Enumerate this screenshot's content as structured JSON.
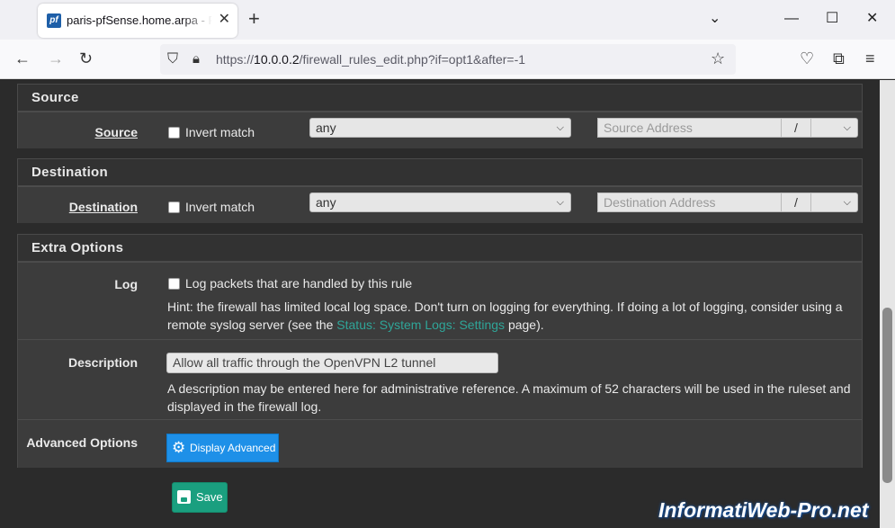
{
  "browser": {
    "tab_title": "paris-pfSense.home.arpa - Firewall",
    "tab_favicon": "pf",
    "url_prefix": "https://",
    "url_host": "10.0.0.2",
    "url_path": "/firewall_rules_edit.php?if=opt1&after=-1"
  },
  "source": {
    "section_title": "Source",
    "label": "Source",
    "invert_label": "Invert match",
    "type_value": "any",
    "address_placeholder": "Source Address",
    "slash": "/"
  },
  "destination": {
    "section_title": "Destination",
    "label": "Destination",
    "invert_label": "Invert match",
    "type_value": "any",
    "address_placeholder": "Destination Address",
    "slash": "/"
  },
  "extra": {
    "section_title": "Extra Options",
    "log_label": "Log",
    "log_checkbox_label": "Log packets that are handled by this rule",
    "log_hint_1": "Hint: the firewall has limited local log space. Don't turn on logging for everything. If doing a lot of logging, consider using a",
    "log_hint_2_pre": "remote syslog server (see the ",
    "log_hint_link": "Status: System Logs: Settings",
    "log_hint_2_post": " page).",
    "description_label": "Description",
    "description_value": "Allow all traffic through the OpenVPN L2 tunnel",
    "description_hint_1": "A description may be entered here for administrative reference. A maximum of 52 characters will be used in the ruleset and",
    "description_hint_2": "displayed in the firewall log.",
    "advanced_label": "Advanced Options",
    "advanced_button": "Display Advanced"
  },
  "save_button": "Save",
  "watermark": "InformatiWeb-Pro.net",
  "colors": {
    "accent_blue": "#1e90e8",
    "save_green": "#1a9f7f",
    "link_teal": "#2fa598"
  }
}
